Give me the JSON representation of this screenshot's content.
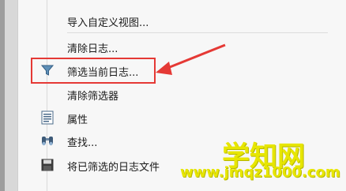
{
  "menu": {
    "items": [
      {
        "label": "导入自定义视图...",
        "icon": ""
      },
      {
        "label": "清除日志...",
        "icon": ""
      },
      {
        "label": "筛选当前日志...",
        "icon": "filter-icon"
      },
      {
        "label": "清除筛选器",
        "icon": ""
      },
      {
        "label": "属性",
        "icon": "properties-icon"
      },
      {
        "label": "查找...",
        "icon": "binoculars-icon"
      },
      {
        "label": "将已筛选的日志文件",
        "icon": "save-icon"
      }
    ]
  },
  "annotation": {
    "highlight_color": "#e53935"
  },
  "watermark": {
    "brand": "学知网",
    "url": "www.jmqz1000.com"
  }
}
